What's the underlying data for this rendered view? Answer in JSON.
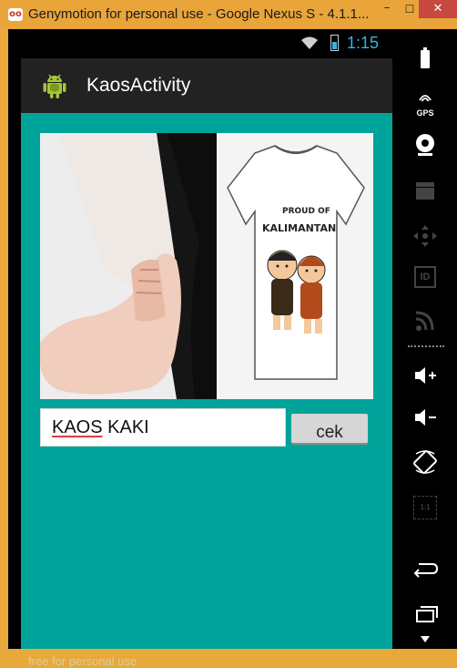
{
  "window": {
    "title": "Genymotion for personal use - Google Nexus S - 4.1.1...",
    "app_icon_label": "oo",
    "minimize": "–",
    "maximize": "☐",
    "close": "✕"
  },
  "status_bar": {
    "time": "1:15",
    "icons": [
      "wifi-icon",
      "battery-icon"
    ]
  },
  "action_bar": {
    "title": "KaosActivity",
    "icon": "android-icon"
  },
  "main": {
    "images": [
      "sock-foot-photo",
      "proud-of-kalimantan-tshirt"
    ],
    "tshirt_print_text": "PROUD OF KALIMANTAN",
    "input_value_part1": "KAOS",
    "input_value_part2": " KAKI",
    "button_label": "cek",
    "watermark": "free for personal use"
  },
  "control_panel": {
    "gps_label": "GPS",
    "id_label": "ID",
    "scale_label": "1:1",
    "icons": [
      "battery-icon",
      "gps-icon",
      "webcam-icon",
      "clapperboard-icon",
      "dpad-icon",
      "id-icon",
      "rss-icon",
      "volume-up-icon",
      "volume-down-icon",
      "rotate-icon",
      "scale-icon",
      "back-icon",
      "recent-apps-icon"
    ]
  },
  "colors": {
    "window_frame": "#e8a83a",
    "close_button": "#c7483f",
    "content_background": "#00a39a",
    "holo_blue": "#33b5e5",
    "action_bar": "#222222"
  }
}
